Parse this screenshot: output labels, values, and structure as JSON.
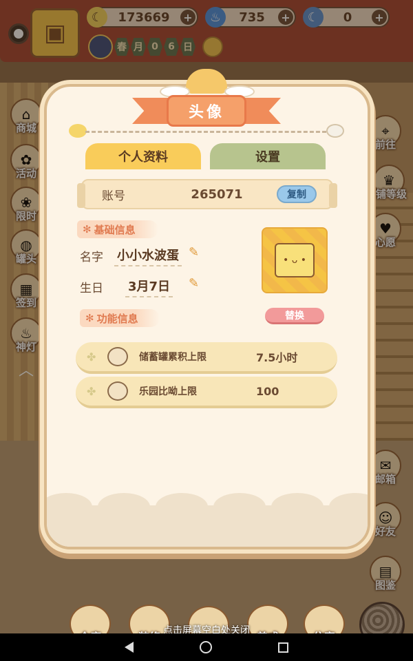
{
  "resources": [
    {
      "icon": "banana-icon",
      "value": "173669"
    },
    {
      "icon": "blue-flame-icon",
      "value": "735"
    },
    {
      "icon": "blue-banana-icon",
      "value": "0"
    }
  ],
  "season": [
    "春",
    "月",
    "0",
    "6",
    "日"
  ],
  "left_menu": [
    "商城",
    "活动",
    "限时",
    "罐头",
    "签到",
    "神灯"
  ],
  "right_menu": [
    "前往",
    "店铺等级",
    "心愿",
    "邮箱",
    "好友",
    "图鉴"
  ],
  "bottom_menu": [
    "仓库",
    "装修",
    "",
    "养成",
    "住客"
  ],
  "close_hint": "点击屏幕空白处关闭",
  "dialog": {
    "title": "头像",
    "tabs": {
      "profile": "个人资料",
      "settings": "设置"
    },
    "account": {
      "label": "账号",
      "value": "265071",
      "copy": "复制"
    },
    "basic_section": "基础信息",
    "name_label": "名字",
    "name_value": "小小水波蛋",
    "birthday_label": "生日",
    "birthday_value": "3月7日",
    "function_section": "功能信息",
    "replace": "替换",
    "rows": [
      {
        "label": "储蓄罐累积上限",
        "value": "7.5小时"
      },
      {
        "label": "乐园比呦上限",
        "value": "100"
      }
    ]
  },
  "colors": {
    "ribbon": "#f08c5a",
    "tab_active": "#f9cc5a",
    "tab_inactive": "#b7c48e",
    "copy_button": "#9ac8ea",
    "replace_button": "#f29a9a"
  }
}
